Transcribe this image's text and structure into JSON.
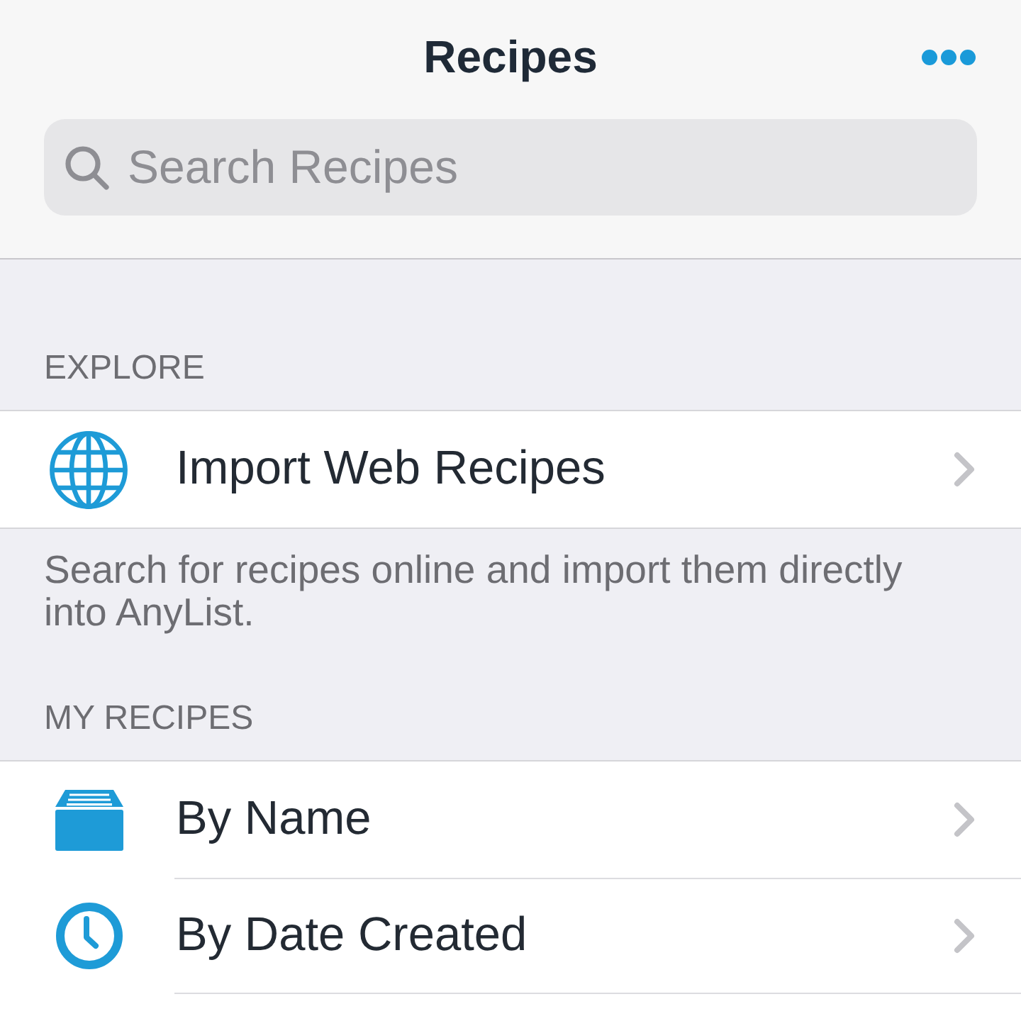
{
  "nav_bar": {
    "title": "Recipes"
  },
  "search": {
    "placeholder": "Search Recipes"
  },
  "sections": [
    {
      "header": "EXPLORE",
      "items": [
        {
          "kind": "import",
          "label": "Import Web Recipes"
        }
      ],
      "footer": "Search for recipes online and import them directly into AnyList."
    },
    {
      "header": "MY RECIPES",
      "items": [
        {
          "kind": "name",
          "label": "By Name"
        },
        {
          "kind": "date",
          "label": "By Date Created"
        }
      ]
    }
  ]
}
